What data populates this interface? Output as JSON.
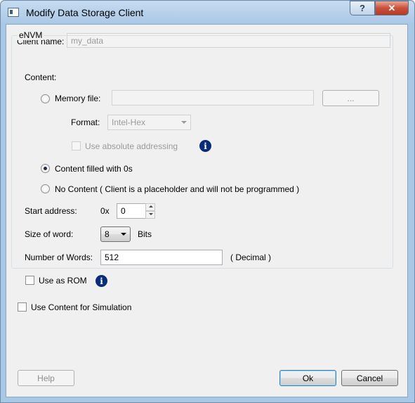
{
  "window": {
    "title": "Modify Data Storage Client",
    "help_glyph": "?",
    "close_glyph": "✕"
  },
  "client_name": {
    "label": "Client name:",
    "value": "my_data"
  },
  "envm": {
    "group_label": "eNVM",
    "content_label": "Content:",
    "memory_file": {
      "label": "Memory file:",
      "value": "",
      "browse_label": "...",
      "selected": false
    },
    "format": {
      "label": "Format:",
      "value": "Intel-Hex"
    },
    "absolute_addressing": {
      "label": "Use absolute addressing",
      "checked": false
    },
    "filled_zeros": {
      "label": "Content filled with 0s",
      "selected": true
    },
    "no_content": {
      "label": "No Content ( Client is a placeholder and will not be programmed )",
      "selected": false
    },
    "start_address": {
      "label": "Start address:",
      "prefix": "0x",
      "value": "0"
    },
    "word_size": {
      "label": "Size of word:",
      "value": "8",
      "unit": "Bits"
    },
    "number_of_words": {
      "label": "Number of Words:",
      "value": "512",
      "unit": "( Decimal )"
    },
    "use_as_rom": {
      "label": "Use as ROM",
      "checked": false
    }
  },
  "use_content_simulation": {
    "label": "Use Content for Simulation",
    "checked": false
  },
  "footer": {
    "help_label": "Help",
    "ok_label": "Ok",
    "cancel_label": "Cancel"
  },
  "icons": {
    "info": "info-icon"
  },
  "colors": {
    "info_icon": "#0a2a7a",
    "title_bar": "#a9c7e6",
    "close_button": "#c9503a"
  }
}
